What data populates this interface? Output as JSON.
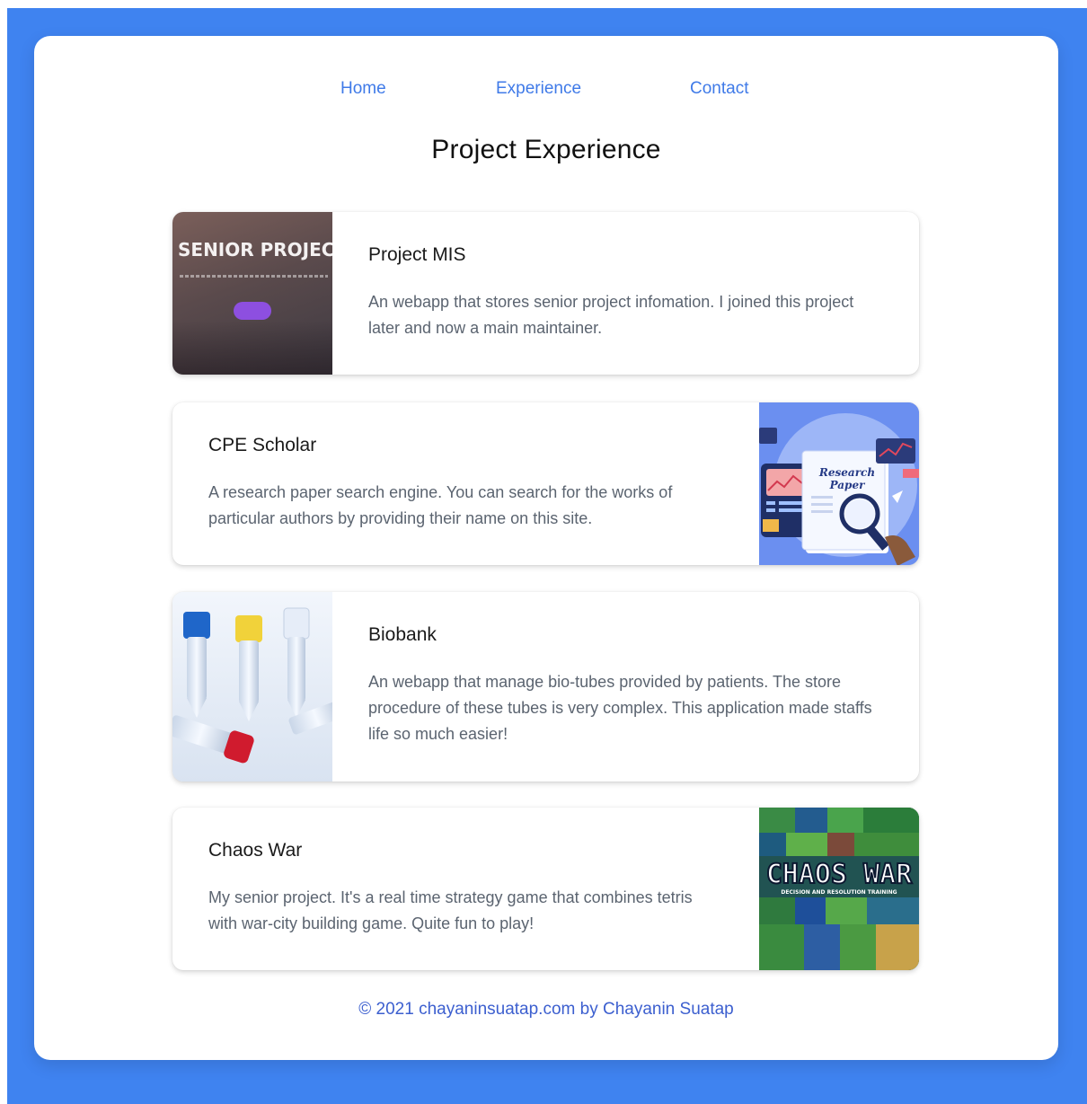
{
  "nav": {
    "home": "Home",
    "experience": "Experience",
    "contact": "Contact"
  },
  "page_title": "Project Experience",
  "projects": [
    {
      "title": "Project MIS",
      "description": "An webapp that stores senior project infomation. I joined this project later and now a main maintainer.",
      "thumb_text": "SENIOR PROJECT"
    },
    {
      "title": "CPE Scholar",
      "description": "A research paper search engine. You can search for the works of particular authors by providing their name on this site.",
      "thumb_text_1": "Research",
      "thumb_text_2": "Paper"
    },
    {
      "title": "Biobank",
      "description": "An webapp that manage bio-tubes provided by patients. The store procedure of these tubes is very complex. This application made staffs life so much easier!"
    },
    {
      "title": "Chaos War",
      "description": "My senior project. It's a real time strategy game that combines tetris with war-city building game. Quite fun to play!",
      "thumb_text": "CHAOS WAR",
      "thumb_subtext": "DECISION AND RESOLUTION TRAINING"
    }
  ],
  "footer": "© 2021 chayaninsuatap.com by Chayanin Suatap",
  "colors": {
    "frame": "#3f83f0",
    "nav_link": "#3f7ae8",
    "footer_text": "#3c5fcf"
  }
}
